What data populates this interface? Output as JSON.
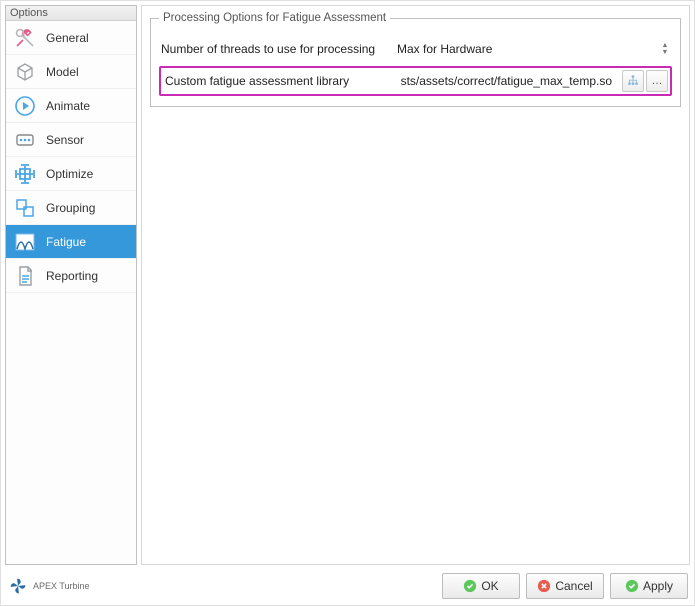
{
  "sidebar": {
    "title": "Options",
    "items": [
      {
        "label": "General"
      },
      {
        "label": "Model"
      },
      {
        "label": "Animate"
      },
      {
        "label": "Sensor"
      },
      {
        "label": "Optimize"
      },
      {
        "label": "Grouping"
      },
      {
        "label": "Fatigue"
      },
      {
        "label": "Reporting"
      }
    ]
  },
  "panel": {
    "legend": "Processing Options for Fatigue Assessment",
    "threads_label": "Number of threads to use for processing",
    "threads_value": "Max for Hardware",
    "library_label": "Custom fatigue assessment library",
    "library_value": "gm-core/tests/assets/correct/fatigue_max_temp.so"
  },
  "footer": {
    "brand": "APEX Turbine",
    "ok": "OK",
    "cancel": "Cancel",
    "apply": "Apply"
  }
}
